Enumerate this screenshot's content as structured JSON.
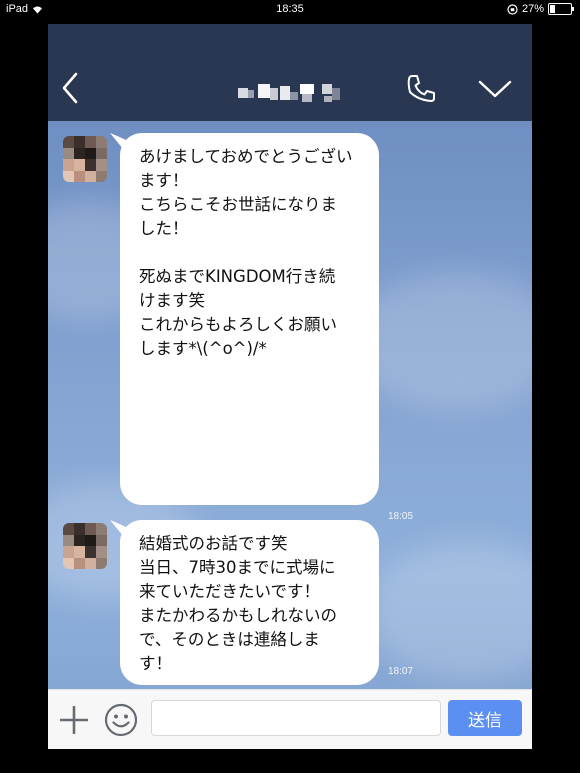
{
  "status_bar": {
    "device": "iPad",
    "time": "18:35",
    "battery": "27%",
    "battery_level": 0.27
  },
  "header": {
    "back_icon": "chevron-left-icon",
    "call_icon": "phone-icon",
    "menu_icon": "chevron-down-icon",
    "contact_name_obscured": true
  },
  "messages": [
    {
      "sender": "other",
      "text": "あけましておめでとうござい\nます！\nこちらこそお世話になりま\nした！\n\n死ぬまでKINGDOM行き続\nけます笑\nこれからもよろしくお願い\nします*\\(^o^)/*",
      "time": "18:05"
    },
    {
      "sender": "other",
      "text": "結婚式のお話です笑\n当日、7時30までに式場に\n来ていただきたいです！\nまたかわるかもしれないの\nで、そのときは連絡しま\nす！",
      "time": "18:07"
    }
  ],
  "input_bar": {
    "plus_icon": "plus-icon",
    "emoji_icon": "smiley-icon",
    "input_value": "",
    "send_label": "送信"
  },
  "colors": {
    "header_bg": "#293752",
    "send_button": "#5b8ff1",
    "bubble": "#ffffff"
  }
}
